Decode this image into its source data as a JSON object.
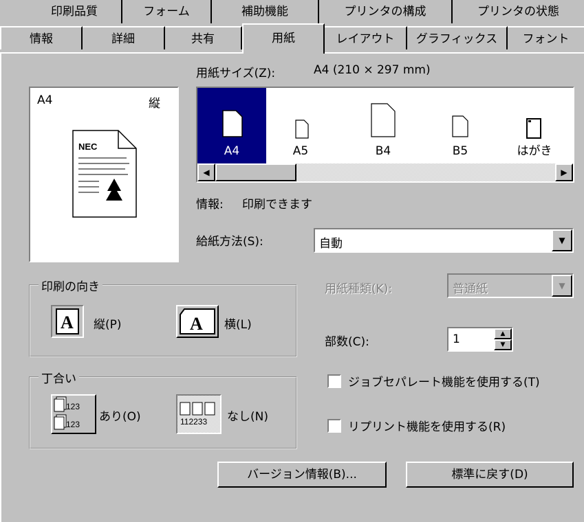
{
  "tabs_back": [
    "印刷品質",
    "フォーム",
    "補助機能",
    "プリンタの構成",
    "プリンタの状態"
  ],
  "tabs_front": [
    "情報",
    "詳細",
    "共有",
    "用紙",
    "レイアウト",
    "グラフィックス",
    "フォント"
  ],
  "paper_size": {
    "label": "用紙サイズ(Z):",
    "value": "A4 (210 × 297 mm)"
  },
  "preview": {
    "size": "A4",
    "orientation": "縦",
    "logo": "NEC"
  },
  "papers": [
    {
      "name": "A4",
      "selected": true
    },
    {
      "name": "A5",
      "selected": false
    },
    {
      "name": "B4",
      "selected": false
    },
    {
      "name": "B5",
      "selected": false
    },
    {
      "name": "はがき",
      "selected": false
    }
  ],
  "info": {
    "label": "情報:",
    "value": "印刷できます"
  },
  "feed": {
    "label": "給紙方法(S):",
    "value": "自動"
  },
  "media": {
    "label": "用紙種類(K):",
    "value": "普通紙"
  },
  "copies": {
    "label": "部数(C):",
    "value": "1"
  },
  "orientation_group": {
    "title": "印刷の向き",
    "portrait": "縦(P)",
    "landscape": "横(L)"
  },
  "collate_group": {
    "title": "丁合い",
    "yes": "あり(O)",
    "no": "なし(N)",
    "icon_text": "123",
    "icon_text2": "112233"
  },
  "checkboxes": {
    "job_separator": "ジョブセパレート機能を使用する(T)",
    "reprint": "リプリント機能を使用する(R)"
  },
  "buttons": {
    "version": "バージョン情報(B)...",
    "defaults": "標準に戻す(D)"
  }
}
